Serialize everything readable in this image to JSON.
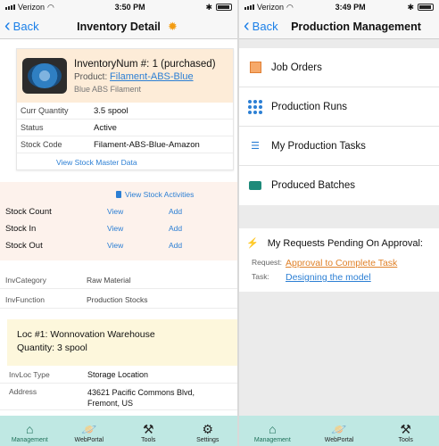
{
  "left": {
    "status": {
      "carrier": "Verizon",
      "time": "3:50 PM"
    },
    "nav": {
      "back_label": "Back",
      "title": "Inventory Detail"
    },
    "product_card": {
      "inventory_num": "InventoryNum #: 1 (purchased)",
      "product_prefix": "Product:",
      "product_link": "Filament-ABS-Blue",
      "subtitle": "Blue ABS Filament",
      "fields": [
        {
          "label": "Curr Quantity",
          "value": "3.5 spool"
        },
        {
          "label": "Status",
          "value": "Active"
        },
        {
          "label": "Stock Code",
          "value": "Filament-ABS-Blue-Amazon"
        }
      ],
      "master_link": "View Stock Master Data"
    },
    "stock_section": {
      "activities_link": "View Stock Activities",
      "rows": [
        {
          "label": "Stock Count",
          "view": "View",
          "add": "Add"
        },
        {
          "label": "Stock In",
          "view": "View",
          "add": "Add"
        },
        {
          "label": "Stock Out",
          "view": "View",
          "add": "Add"
        }
      ]
    },
    "inv_fields": [
      {
        "label": "InvCategory",
        "value": "Raw Material"
      },
      {
        "label": "InvFunction",
        "value": "Production Stocks"
      }
    ],
    "location": {
      "title": "Loc #1: Wonnovation Warehouse",
      "quantity": "Quantity: 3 spool",
      "fields": [
        {
          "label": "InvLoc Type",
          "value": "Storage Location"
        },
        {
          "label": "Address",
          "value": "43621 Pacific Commons Blvd, Fremont, US"
        }
      ]
    },
    "tabs": [
      {
        "label": "Management",
        "icon": "home-icon"
      },
      {
        "label": "WebPortal",
        "icon": "planet-icon"
      },
      {
        "label": "Tools",
        "icon": "tools-icon"
      },
      {
        "label": "Settings",
        "icon": "settings-icon"
      }
    ]
  },
  "right": {
    "status": {
      "carrier": "Verizon",
      "time": "3:49 PM"
    },
    "nav": {
      "back_label": "Back",
      "title": "Production Management"
    },
    "menu": [
      {
        "label": "Job Orders",
        "icon": "list-box-icon"
      },
      {
        "label": "Production Runs",
        "icon": "grid-dots-icon"
      },
      {
        "label": "My Production Tasks",
        "icon": "task-list-icon"
      },
      {
        "label": "Produced Batches",
        "icon": "tray-icon"
      }
    ],
    "pending": {
      "title": "My Requests Pending On Approval:",
      "request_label": "Request:",
      "request_value": "Approval to Complete Task",
      "task_label": "Task:",
      "task_value": "Designing the model"
    },
    "tabs": [
      {
        "label": "Management",
        "icon": "home-icon"
      },
      {
        "label": "WebPortal",
        "icon": "planet-icon"
      },
      {
        "label": "Tools",
        "icon": "tools-icon"
      }
    ]
  },
  "colors": {
    "link": "#2c7fd4",
    "tabbar": "#bfe8e3",
    "accent_orange": "#f39c12"
  }
}
